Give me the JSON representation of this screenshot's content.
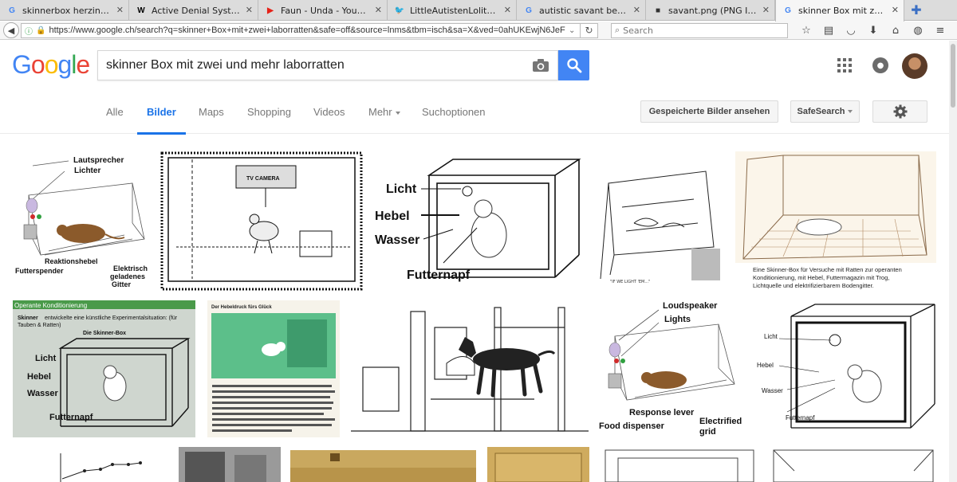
{
  "browser": {
    "tabs": [
      {
        "favicon": "G",
        "favicon_color": "#4285f4",
        "label": "skinnerbox herzinfark..."
      },
      {
        "favicon": "W",
        "favicon_color": "#000000",
        "label": "Active Denial System..."
      },
      {
        "favicon": "▶",
        "favicon_color": "#e62117",
        "label": "Faun - Unda - YouTube"
      },
      {
        "favicon": "🐦",
        "favicon_color": "#1da1f2",
        "label": "LittleAutistenLolita o..."
      },
      {
        "favicon": "G",
        "favicon_color": "#4285f4",
        "label": "autistic savant bewar..."
      },
      {
        "favicon": "■",
        "favicon_color": "#333333",
        "label": "savant.png (PNG Imag..."
      },
      {
        "favicon": "G",
        "favicon_color": "#4285f4",
        "label": "skinner Box mit zwei ..."
      }
    ],
    "active_tab": 6,
    "url": "https://www.google.ch/search?q=skinner+Box+mit+zwei+laborratten&safe=off&source=lnms&tbm=isch&sa=X&ved=0ahUKEwjN6JeF",
    "search_placeholder": "Search"
  },
  "google": {
    "logo": "Google",
    "query": "skinner Box mit zwei und mehr laborratten",
    "colors": {
      "blue": "#4285f4",
      "red": "#ea4335",
      "yellow": "#fbbc05",
      "green": "#34a853",
      "accent": "#1a73e8"
    },
    "tabs": [
      "Alle",
      "Bilder",
      "Maps",
      "Shopping",
      "Videos",
      "Mehr",
      "Suchoptionen"
    ],
    "active_tab": "Bilder",
    "saved_images_button": "Gespeicherte Bilder ansehen",
    "safesearch": "SafeSearch"
  },
  "results": {
    "t1": {
      "a": "Lautsprecher",
      "b": "Lichter",
      "c": "Reaktionshebel",
      "d": "Futterspender",
      "e": "Elektrisch",
      "f": "geladenes",
      "g": "Gitter"
    },
    "t2": {
      "a": "TV CAMERA"
    },
    "t3": {
      "a": "Licht",
      "b": "Hebel",
      "c": "Wasser",
      "d": "Futternapf"
    },
    "t5": {
      "a": "Eine Skinner-Box für Versuche mit Ratten zur operanten",
      "b": "Konditionierung, mit Hebel, Futtermagazin mit Trog,",
      "c": "Lichtquelle und elektrifizierbarem Bodengitter."
    },
    "t6": {
      "a": "Operante Konditionierung",
      "b": "Skinner",
      "c": "entwickelte eine künstliche Experimentalsituation: (für",
      "d": "Tauben & Ratten)",
      "e": "Die Skinner-Box",
      "f": "Licht",
      "g": "Hebel",
      "h": "Wasser",
      "i": "Futternapf"
    },
    "t7": {
      "a": "Der Hebeldruck fürs Glück"
    },
    "t9": {
      "a": "Loudspeaker",
      "b": "Lights",
      "c": "Response lever",
      "d": "Food dispenser",
      "e": "Electrified",
      "f": "grid"
    },
    "t10": {
      "a": "Licht",
      "b": "Hebel",
      "c": "Wasser",
      "d": "Futternapf"
    }
  }
}
